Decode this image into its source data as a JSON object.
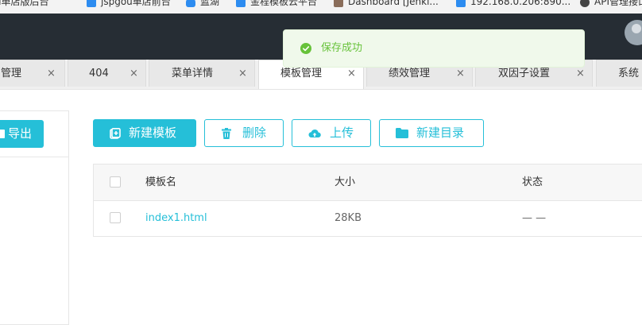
{
  "bookmarks": [
    {
      "label": "jspGou单店版后台",
      "icon": "bookmark-icon"
    },
    {
      "label": "jspgou单店前台",
      "icon": "bookmark-icon"
    },
    {
      "label": "蓝湖",
      "icon": "bell-icon"
    },
    {
      "label": "金程模板云平台",
      "icon": "bookmark-icon"
    },
    {
      "label": "Dashboard [Jenki...",
      "icon": "jenkins-icon"
    },
    {
      "label": "192.168.0.206:890...",
      "icon": "bookmark-icon"
    },
    {
      "label": "API管理接口",
      "icon": "globe-icon"
    }
  ],
  "tabs": [
    {
      "label": "管理",
      "close": "×"
    },
    {
      "label": "404",
      "close": "×"
    },
    {
      "label": "菜单详情",
      "close": "×"
    },
    {
      "label": "模板管理",
      "close": "×",
      "active": true
    },
    {
      "label": "绩效管理",
      "close": "×"
    },
    {
      "label": "双因子设置",
      "close": "×"
    },
    {
      "label": "系统"
    }
  ],
  "left_panel": {
    "export_label": "导出"
  },
  "toolbar": {
    "new_template": "新建模板",
    "delete": "删除",
    "upload": "上传",
    "new_directory": "新建目录"
  },
  "table": {
    "headers": {
      "name": "模板名",
      "size": "大小",
      "status": "状态"
    },
    "rows": [
      {
        "name": "index1.html",
        "size": "28KB",
        "status": "— —"
      }
    ]
  },
  "toast": {
    "message": "保存成功",
    "color": "#67c23a"
  },
  "colors": {
    "accent": "#25bfd8",
    "header_bg": "#262d34",
    "toast_bg": "#f0f9eb"
  }
}
